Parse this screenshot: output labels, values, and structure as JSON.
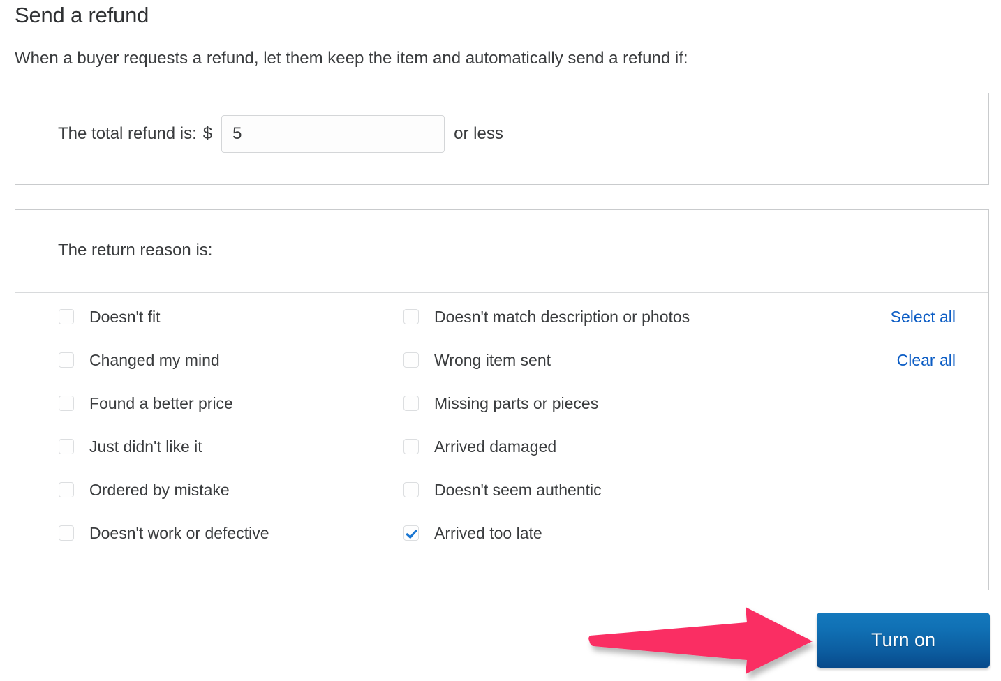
{
  "header": {
    "title": "Send a refund",
    "subtitle": "When a buyer requests a refund, let them keep the item and automatically send a refund if:"
  },
  "amount_panel": {
    "label": "The total refund is:",
    "currency_symbol": "$",
    "value": "5",
    "placeholder": "",
    "suffix": "or less"
  },
  "reasons_panel": {
    "header_label": "The return reason is:",
    "left_column": [
      {
        "label": "Doesn't fit",
        "checked": false
      },
      {
        "label": "Changed my mind",
        "checked": false
      },
      {
        "label": "Found a better price",
        "checked": false
      },
      {
        "label": "Just didn't like it",
        "checked": false
      },
      {
        "label": "Ordered by mistake",
        "checked": false
      },
      {
        "label": "Doesn't work or defective",
        "checked": false
      }
    ],
    "right_column": [
      {
        "label": "Doesn't match description or photos",
        "checked": false
      },
      {
        "label": "Wrong item sent",
        "checked": false
      },
      {
        "label": "Missing parts or pieces",
        "checked": false
      },
      {
        "label": "Arrived damaged",
        "checked": false
      },
      {
        "label": "Doesn't seem authentic",
        "checked": false
      },
      {
        "label": "Arrived too late",
        "checked": true
      }
    ],
    "bulk_actions": {
      "select_all": "Select all",
      "clear_all": "Clear all"
    }
  },
  "footer": {
    "primary_button": "Turn on"
  },
  "annotation": {
    "arrow": "right-arrow-pointing-to-turn-on-button"
  },
  "colors": {
    "link": "#0b5cc4",
    "button_top": "#1479bd",
    "button_bottom": "#084a8b",
    "checkmark": "#1976d2",
    "annotation_arrow": "#fa2d63",
    "panel_border": "#c9cbcd",
    "text": "#3a3c3e"
  }
}
